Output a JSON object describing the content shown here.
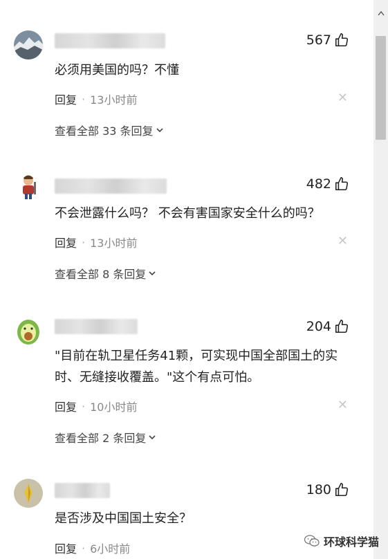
{
  "comments": [
    {
      "likes": "567",
      "text": "必须用美国的吗？不懂",
      "reply_label": "回复",
      "time": "13小时前",
      "view_all": "查看全部 33 条回复"
    },
    {
      "likes": "482",
      "text": "不会泄露什么吗？ 不会有害国家安全什么的吗？",
      "reply_label": "回复",
      "time": "13小时前",
      "view_all": "查看全部 8 条回复"
    },
    {
      "likes": "204",
      "text": "\"目前在轨卫星任务41颗，可实现中国全部国土的实时、无缝接收覆盖。\"这个有点可怕。",
      "reply_label": "回复",
      "time": "10小时前",
      "view_all": "查看全部 2 条回复"
    },
    {
      "likes": "180",
      "text": "是否涉及中国国土安全？",
      "reply_label": "回复",
      "time": "6小时前"
    }
  ],
  "watermark": {
    "text": "环球科学猫"
  },
  "colors": {
    "text": "#222222",
    "meta": "#888888",
    "close": "#c8c8c8",
    "scroll_thumb": "#c1c1c1"
  },
  "icons": {
    "like": "thumbs-up-icon",
    "close": "close-icon",
    "expand": "chevron-down-icon"
  }
}
